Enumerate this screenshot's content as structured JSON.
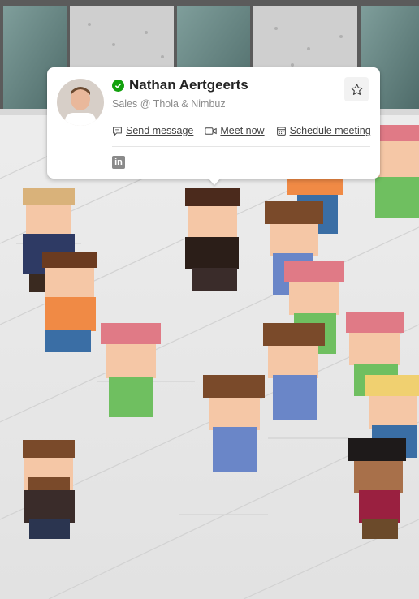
{
  "profile_card": {
    "name": "Nathan Aertgeerts",
    "subtitle": "Sales @ Thola & Nimbuz",
    "presence": "available",
    "presence_color": "#13a10e",
    "favorite_icon": "star-outline-icon",
    "actions": [
      {
        "label": "Send message",
        "icon": "chat-icon"
      },
      {
        "label": "Meet now",
        "icon": "video-camera-icon"
      },
      {
        "label": "Schedule meeting",
        "icon": "calendar-icon"
      }
    ],
    "social": {
      "label": "in",
      "icon": "linkedin-icon"
    }
  },
  "scene": {
    "description_colors": {
      "floor": "#e7e7e7",
      "wall": "#6f8f8d"
    }
  }
}
